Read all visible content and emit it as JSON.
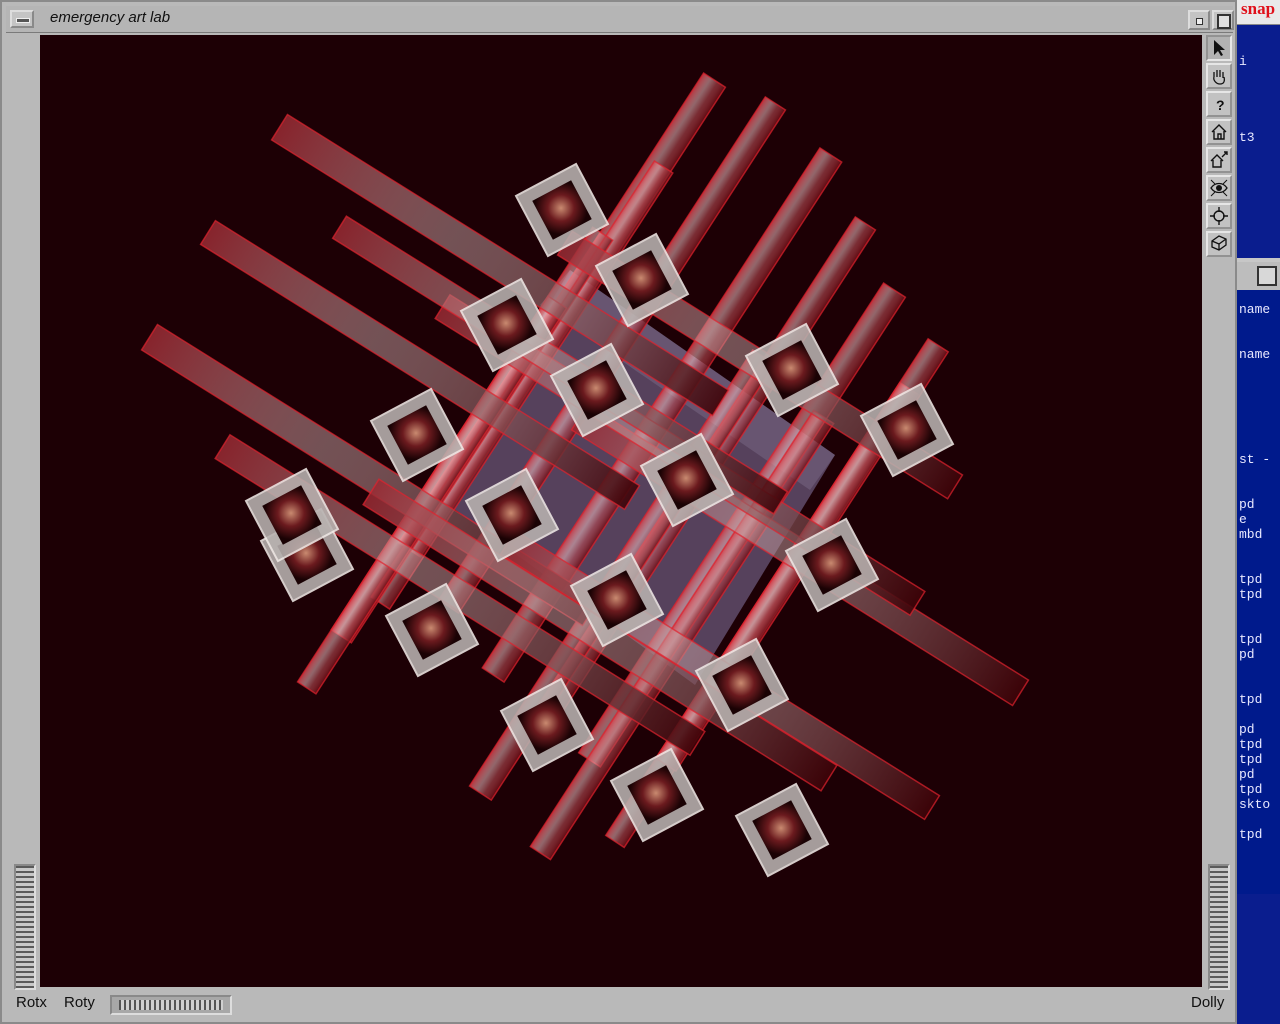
{
  "window": {
    "title": "emergency art lab"
  },
  "toolbar": {
    "tools": [
      {
        "name": "select-arrow-icon"
      },
      {
        "name": "pan-hand-icon"
      },
      {
        "name": "help-icon",
        "glyph": "?"
      },
      {
        "name": "home-icon"
      },
      {
        "name": "set-home-icon"
      },
      {
        "name": "view-all-eye-icon"
      },
      {
        "name": "seek-target-icon"
      },
      {
        "name": "projection-cube-icon"
      }
    ]
  },
  "bottom_bar": {
    "rotx_label": "Rotx",
    "roty_label": "Roty",
    "dolly_label": "Dolly"
  },
  "background_terminal": {
    "title_fragment": "snap",
    "top_fragments": [
      "i",
      "t3"
    ],
    "lines": [
      "name",
      "name",
      "st -",
      "pd",
      "e",
      "mbd",
      "tpd",
      "tpd",
      "tpd",
      "pd",
      "tpd",
      "pd",
      "tpd",
      "tpd",
      "pd",
      "tpd",
      "skto",
      "tpd"
    ]
  },
  "colors": {
    "viewport_background": "#1d0005",
    "window_chrome": "#b9b9b9",
    "terminal_background": "#0a1d8e"
  }
}
